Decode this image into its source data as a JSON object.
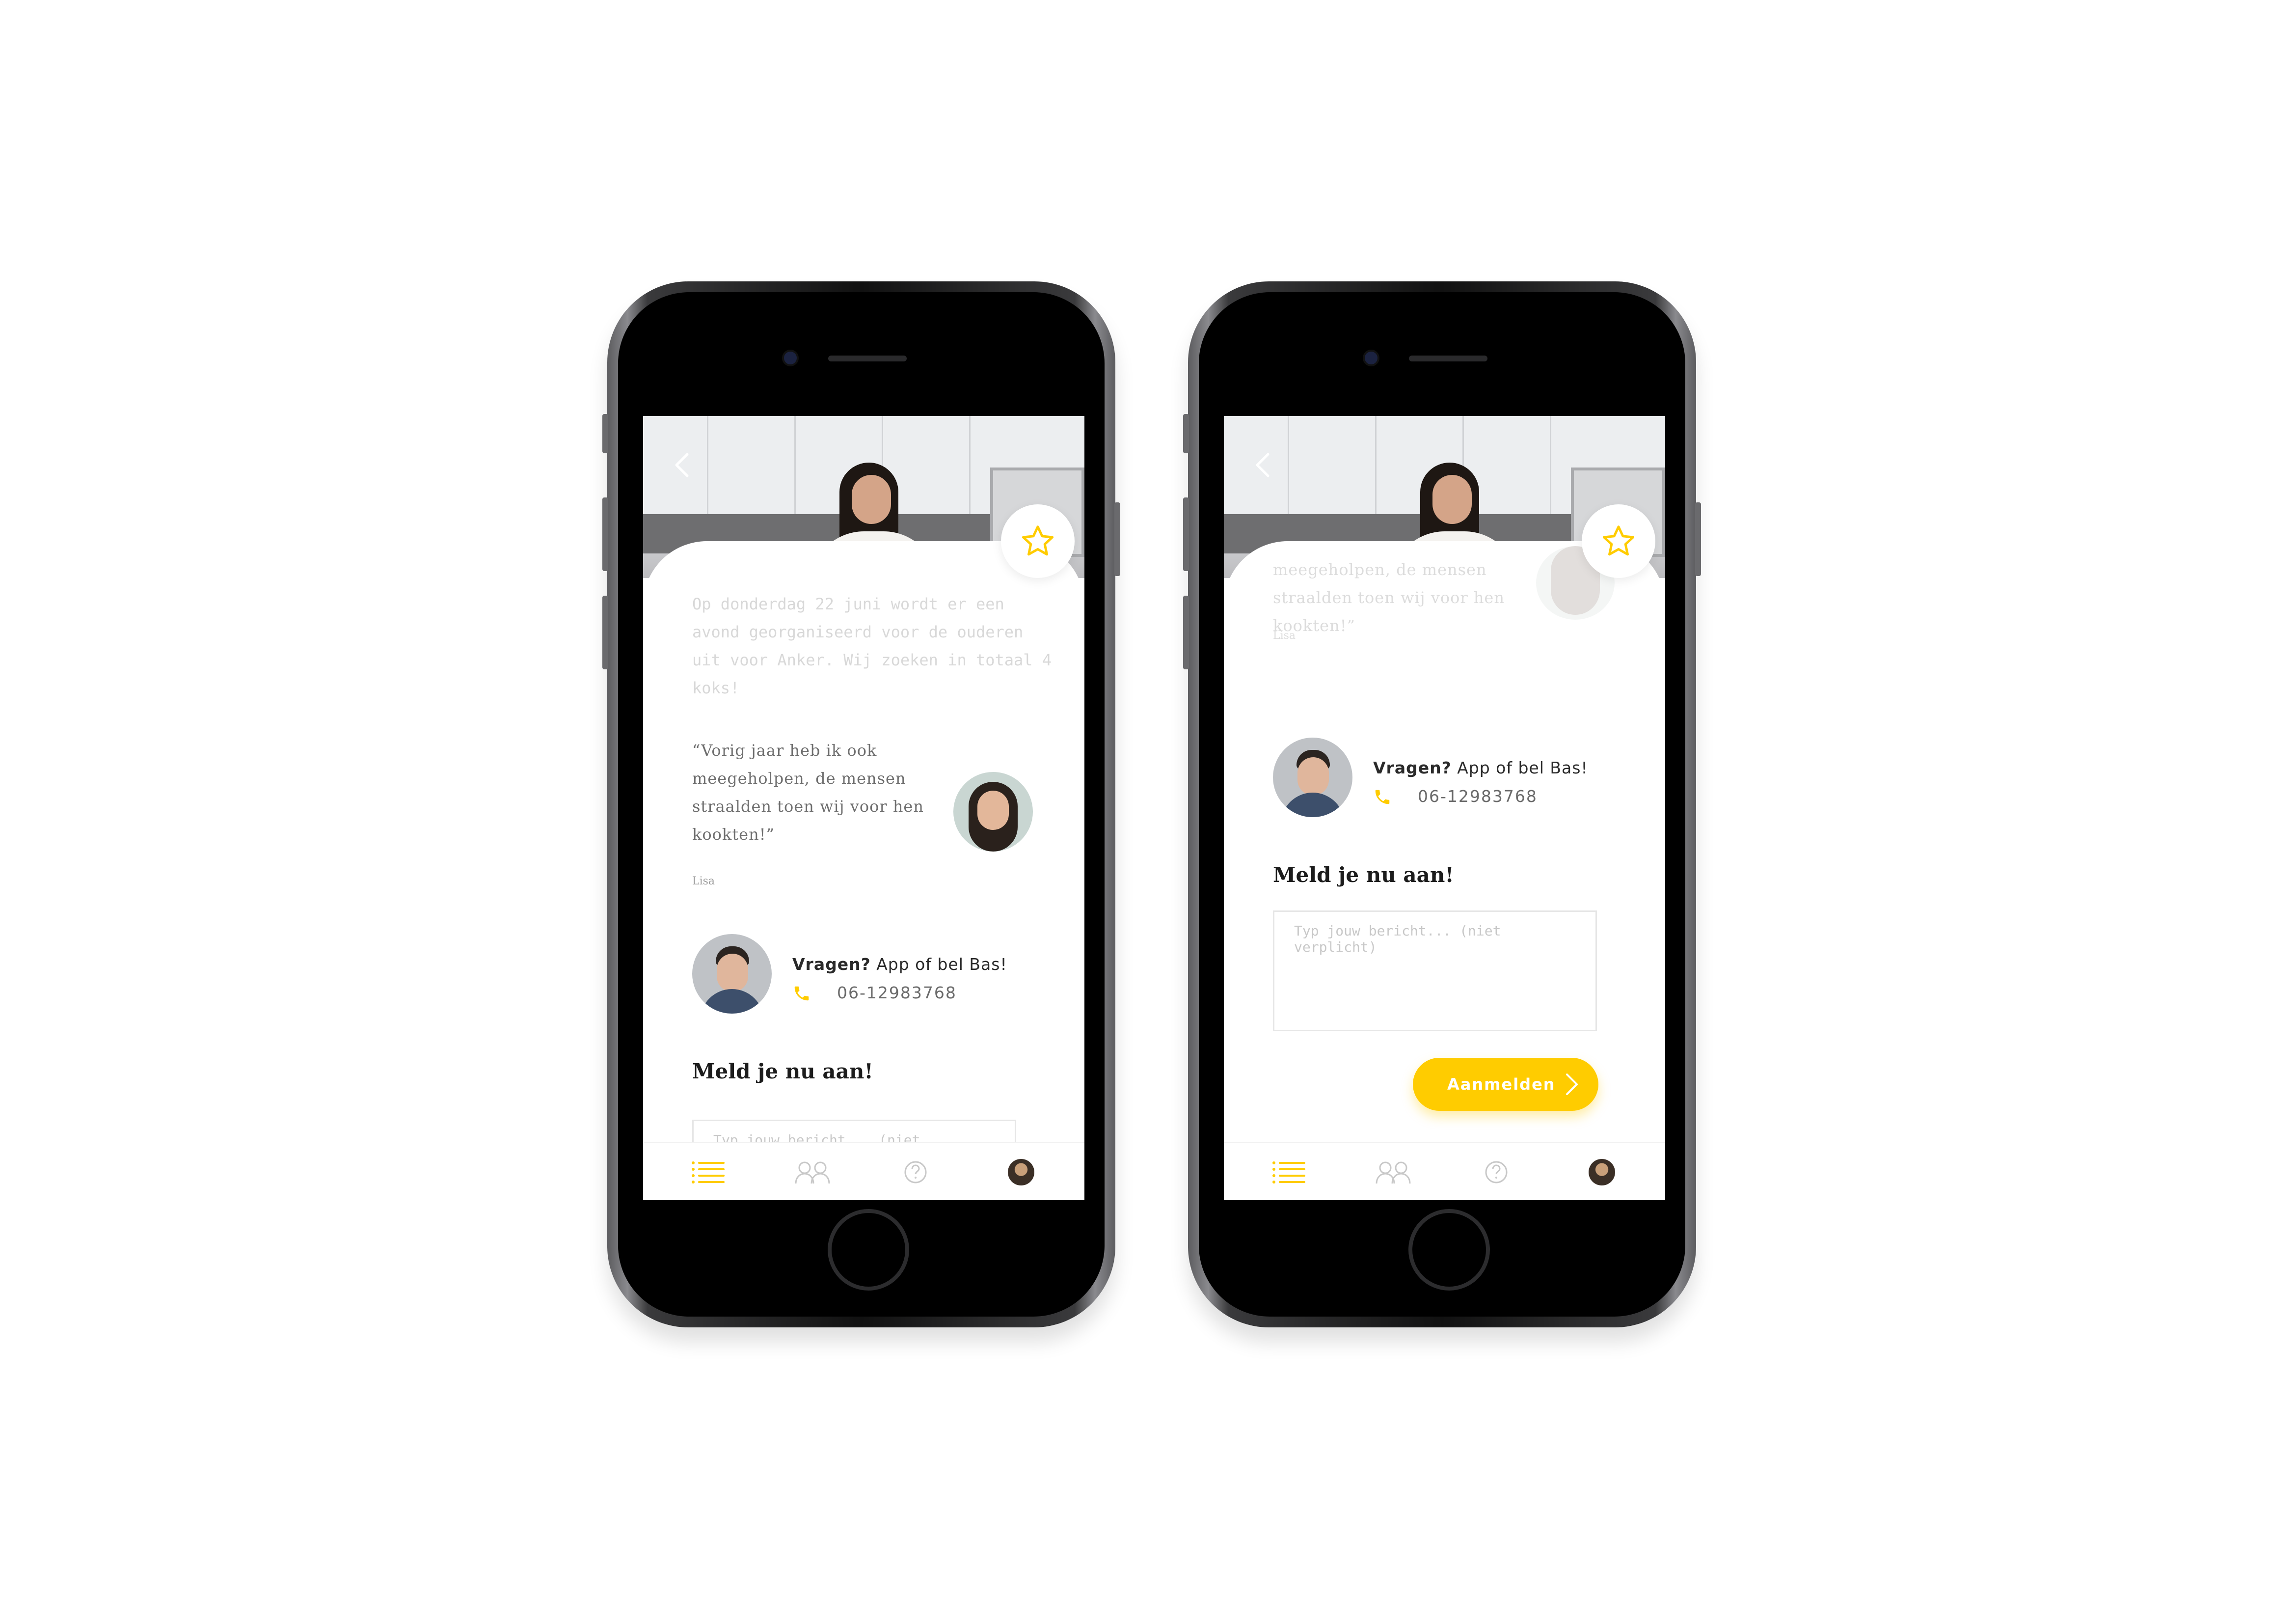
{
  "app": {
    "accent_color": "#FFCC00",
    "faded_intro": [
      "Op donderdag 22 juni wordt er een",
      "avond georganiseerd voor de ouderen",
      "uit voor Anker. Wij zoeken in totaal 4",
      "koks!"
    ],
    "quote": {
      "lines": [
        "“Vorig jaar heb ik ook",
        "meegeholpen, de mensen",
        "straalden toen wij voor hen",
        "kookten!”"
      ],
      "author": "Lisa"
    },
    "faded_quote": [
      "meegeholpen, de mensen",
      "straalden toen wij voor hen",
      "kookten!”"
    ],
    "contact": {
      "question_bold": "Vragen?",
      "question_rest": " App of bel Bas!",
      "phone": "06-12983768",
      "phone_icon": "phone-icon"
    },
    "cta_title": "Meld je nu aan!",
    "message_placeholder": "Typ jouw bericht... (niet verplicht)",
    "submit_label": "Aanmelden",
    "icons": {
      "back": "chevron-left-icon",
      "favorite": "star-icon",
      "tabs": [
        "list-icon",
        "people-icon",
        "help-icon",
        "profile-avatar"
      ]
    }
  }
}
